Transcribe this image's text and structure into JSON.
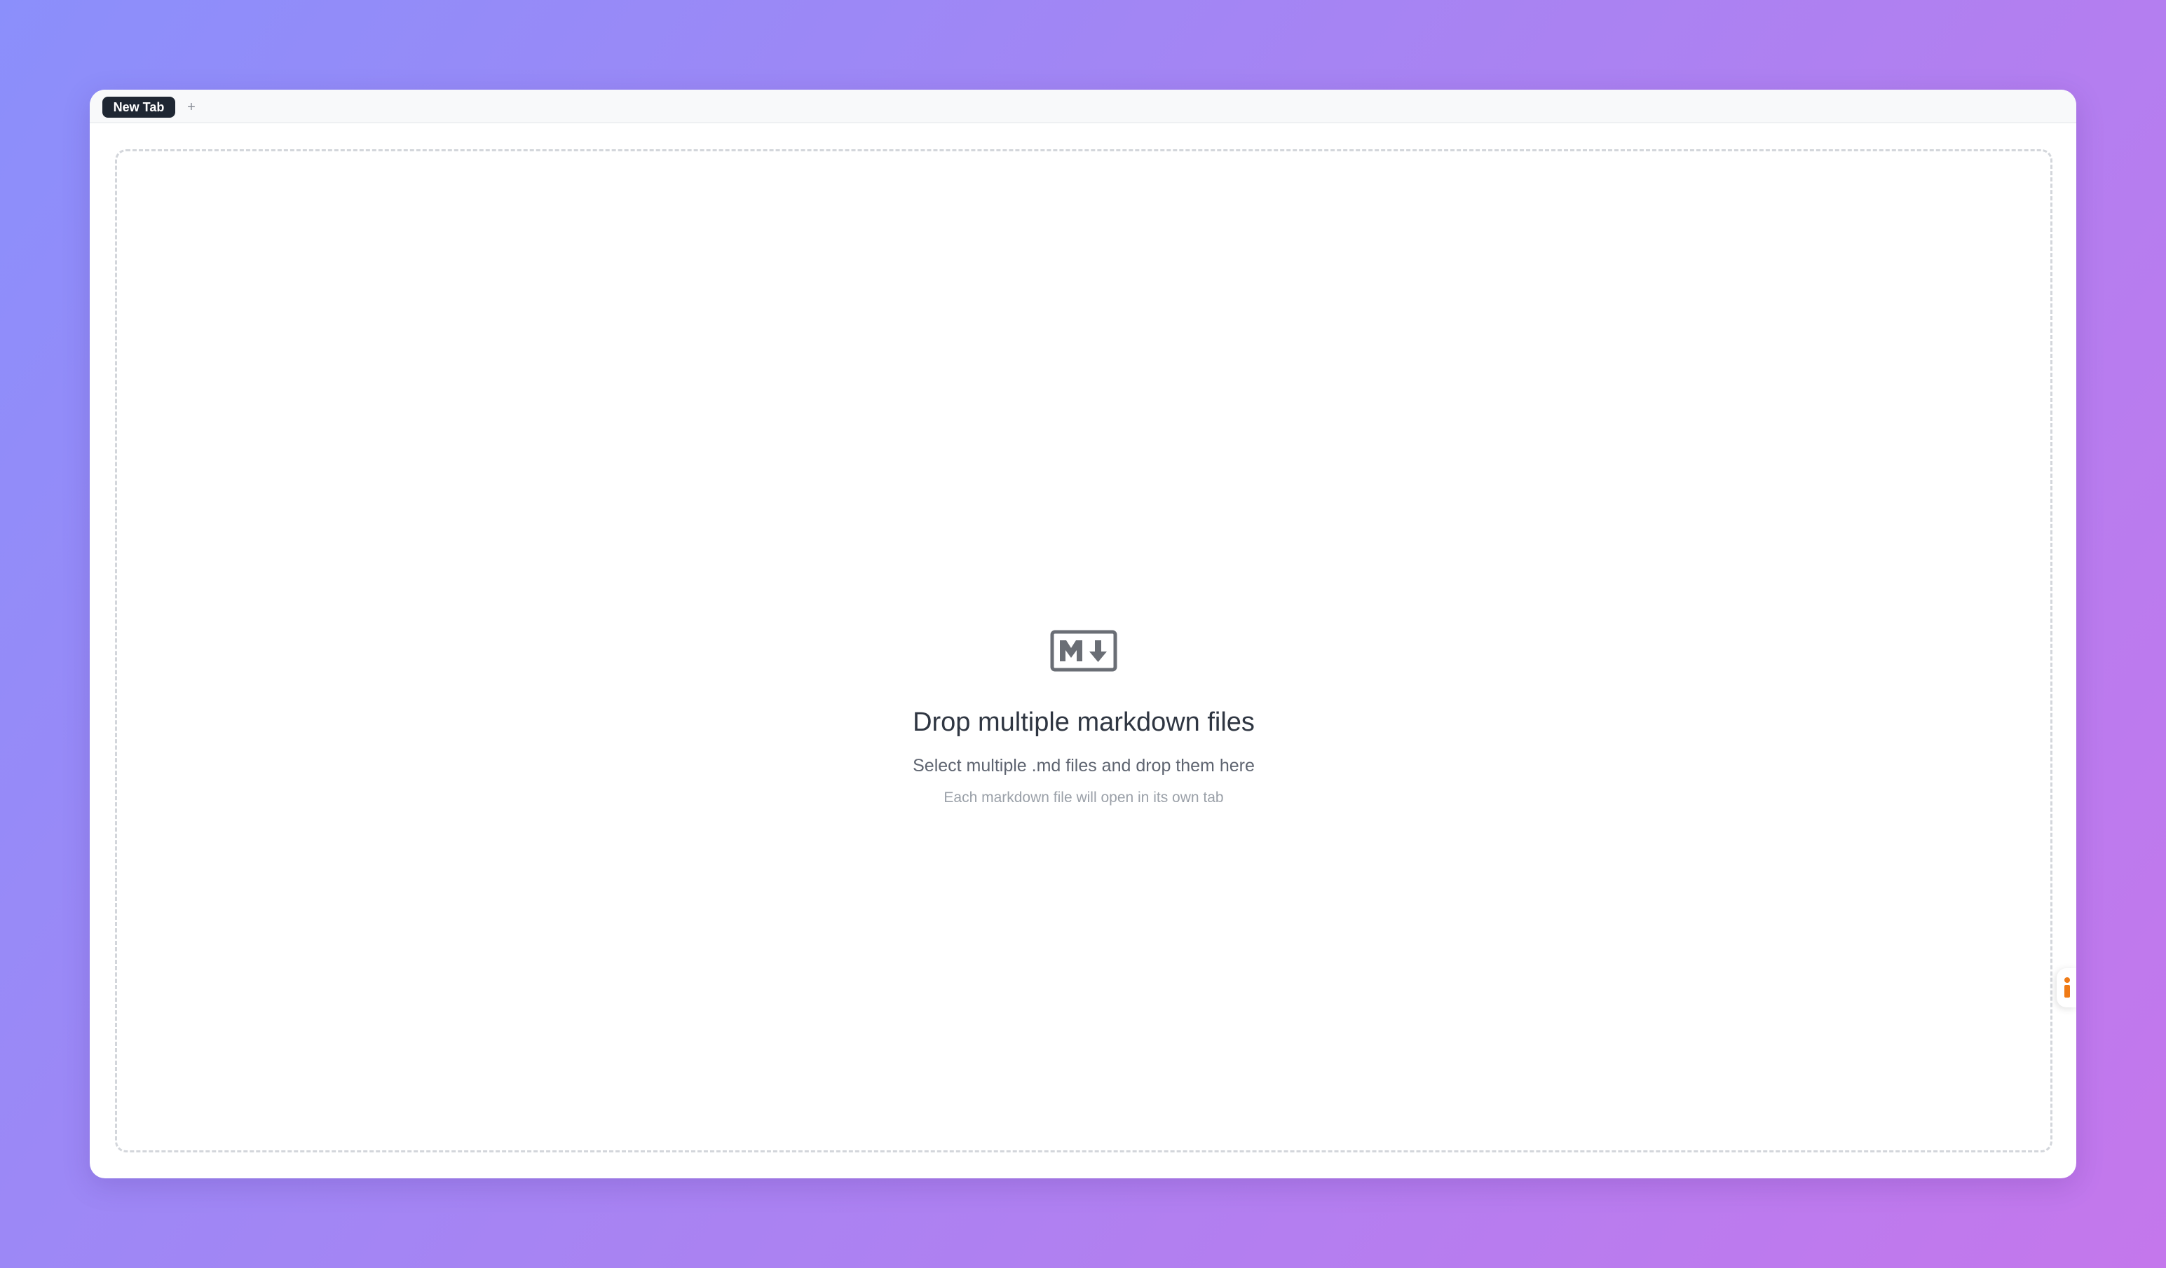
{
  "tabs": {
    "items": [
      {
        "label": "New Tab",
        "active": true
      }
    ],
    "add_label": "+"
  },
  "dropzone": {
    "icon": "markdown-icon",
    "title": "Drop multiple markdown files",
    "subtitle": "Select multiple .md files and drop them here",
    "hint": "Each markdown file will open in its own tab"
  },
  "side_handle": {
    "icon": "info-icon",
    "color": "#f07b16"
  },
  "colors": {
    "active_tab": "#1f2733",
    "background_start": "#8b8ffb",
    "background_end": "#c477ec"
  }
}
